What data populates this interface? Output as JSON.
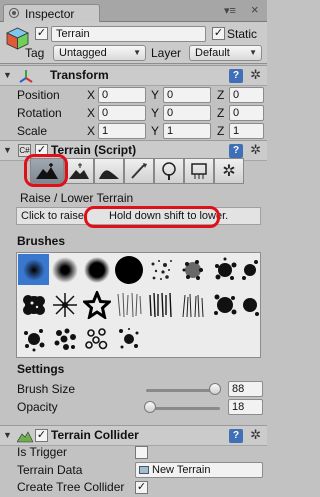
{
  "window": {
    "tab_label": "Inspector",
    "menu_glyph": "▾≡",
    "close_glyph": "×"
  },
  "object": {
    "name": "Terrain",
    "static_label": "Static",
    "static_checked": true,
    "active_checked": true,
    "tag_label": "Tag",
    "tag_value": "Untagged",
    "layer_label": "Layer",
    "layer_value": "Default"
  },
  "transform": {
    "title": "Transform",
    "rows": [
      {
        "label": "Position",
        "x": "0",
        "y": "0",
        "z": "0"
      },
      {
        "label": "Rotation",
        "x": "0",
        "y": "0",
        "z": "0"
      },
      {
        "label": "Scale",
        "x": "1",
        "y": "1",
        "z": "1"
      }
    ],
    "axis_x": "X",
    "axis_y": "Y",
    "axis_z": "Z"
  },
  "terrain_script": {
    "title": "Terrain (Script)",
    "enabled": true,
    "tools": [
      "raise-lower-icon",
      "paint-height-icon",
      "smooth-height-icon",
      "paint-texture-icon",
      "place-trees-icon",
      "paint-details-icon",
      "terrain-settings-icon"
    ],
    "active_tool_index": 0,
    "tool_name": "Raise / Lower Terrain",
    "hint_a": "Click to raise.",
    "hint_b": "Hold down shift to lower.",
    "brushes_label": "Brushes",
    "settings_label": "Settings",
    "brush_size_label": "Brush Size",
    "brush_size_value": "88",
    "brush_size_fraction": 0.93,
    "opacity_label": "Opacity",
    "opacity_value": "18",
    "opacity_fraction": 0.06
  },
  "terrain_collider": {
    "title": "Terrain Collider",
    "enabled": true,
    "is_trigger_label": "Is Trigger",
    "is_trigger_checked": false,
    "terrain_data_label": "Terrain Data",
    "terrain_data_value": "New Terrain",
    "create_tree_collider_label": "Create Tree Collider",
    "create_tree_collider_checked": true
  },
  "colors": {
    "highlight_red": "#e0101a",
    "selected_brush_blue": "#3a78cf",
    "help_blue": "#3f6fb5"
  },
  "glyphs": {
    "check": "✓",
    "gear": "✲",
    "help": "?",
    "fold_open": "▼"
  }
}
